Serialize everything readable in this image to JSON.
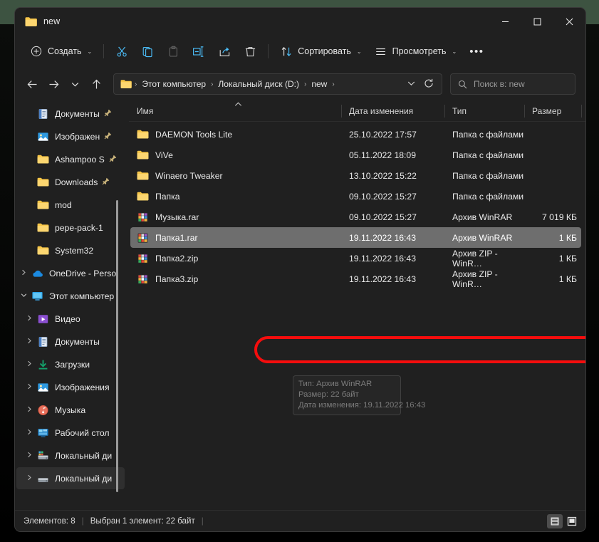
{
  "window": {
    "title": "new",
    "minimize_label": "—",
    "maximize_label": "□",
    "close_label": "✕"
  },
  "toolbar": {
    "new_label": "Создать",
    "cut_label": "Вырезать",
    "copy_label": "Копировать",
    "paste_label": "Вставить",
    "rename_label": "Переименовать",
    "share_label": "Поделиться",
    "delete_label": "Удалить",
    "sort_label": "Сортировать",
    "view_label": "Просмотреть",
    "more_label": "•••"
  },
  "address": {
    "back_label": "←",
    "forward_label": "→",
    "recent_label": "⌄",
    "up_label": "↑",
    "crumbs": [
      "Этот компьютер",
      "Локальный диск (D:)",
      "new"
    ],
    "separator": "›",
    "dropdown_label": "⌄",
    "refresh_label": "↻"
  },
  "search": {
    "placeholder": "Поиск в: new"
  },
  "sidebar": {
    "items": [
      {
        "label": "Документы",
        "icon": "documents-icon",
        "chevron": false,
        "pinned": true,
        "indent": 1,
        "selected": false
      },
      {
        "label": "Изображен",
        "icon": "pictures-icon",
        "chevron": false,
        "pinned": true,
        "indent": 1,
        "selected": false
      },
      {
        "label": "Ashampoo S",
        "icon": "folder-icon",
        "chevron": false,
        "pinned": true,
        "indent": 1,
        "selected": false
      },
      {
        "label": "Downloads",
        "icon": "folder-icon",
        "chevron": false,
        "pinned": true,
        "indent": 1,
        "selected": false
      },
      {
        "label": "mod",
        "icon": "folder-icon",
        "chevron": false,
        "pinned": false,
        "indent": 1,
        "selected": false
      },
      {
        "label": "pepe-pack-1",
        "icon": "folder-icon",
        "chevron": false,
        "pinned": false,
        "indent": 1,
        "selected": false
      },
      {
        "label": "System32",
        "icon": "folder-icon",
        "chevron": false,
        "pinned": false,
        "indent": 1,
        "selected": false
      },
      {
        "label": "OneDrive - Perso",
        "icon": "onedrive-icon",
        "chevron": true,
        "pinned": false,
        "indent": 0,
        "selected": false
      },
      {
        "label": "Этот компьютер",
        "icon": "thispc-icon",
        "chevron": true,
        "expanded": true,
        "pinned": false,
        "indent": 0,
        "selected": false
      },
      {
        "label": "Видео",
        "icon": "video-icon",
        "chevron": true,
        "pinned": false,
        "indent": 1,
        "selected": false
      },
      {
        "label": "Документы",
        "icon": "documents-icon",
        "chevron": true,
        "pinned": false,
        "indent": 1,
        "selected": false
      },
      {
        "label": "Загрузки",
        "icon": "downloads-icon",
        "chevron": true,
        "pinned": false,
        "indent": 1,
        "selected": false
      },
      {
        "label": "Изображения",
        "icon": "pictures-icon",
        "chevron": true,
        "pinned": false,
        "indent": 1,
        "selected": false
      },
      {
        "label": "Музыка",
        "icon": "music-icon",
        "chevron": true,
        "pinned": false,
        "indent": 1,
        "selected": false
      },
      {
        "label": "Рабочий стол",
        "icon": "desktop-icon",
        "chevron": true,
        "pinned": false,
        "indent": 1,
        "selected": false
      },
      {
        "label": "Локальный ди",
        "icon": "sysdrive-icon",
        "chevron": true,
        "pinned": false,
        "indent": 1,
        "selected": false
      },
      {
        "label": "Локальный ди",
        "icon": "drive-icon",
        "chevron": true,
        "pinned": false,
        "indent": 1,
        "selected": true
      }
    ]
  },
  "columns": {
    "name": "Имя",
    "date": "Дата изменения",
    "type": "Тип",
    "size": "Размер",
    "sort_indicator": "⌃"
  },
  "files": [
    {
      "name": "DAEMON Tools Lite",
      "date": "25.10.2022 17:57",
      "type": "Папка с файлами",
      "size": "",
      "icon": "folder-icon",
      "selected": false
    },
    {
      "name": "ViVe",
      "date": "05.11.2022 18:09",
      "type": "Папка с файлами",
      "size": "",
      "icon": "folder-icon",
      "selected": false
    },
    {
      "name": "Winaero Tweaker",
      "date": "13.10.2022 15:22",
      "type": "Папка с файлами",
      "size": "",
      "icon": "folder-icon",
      "selected": false
    },
    {
      "name": "Папка",
      "date": "09.10.2022 15:27",
      "type": "Папка с файлами",
      "size": "",
      "icon": "folder-icon",
      "selected": false
    },
    {
      "name": "Музыка.rar",
      "date": "09.10.2022 15:27",
      "type": "Архив WinRAR",
      "size": "7 019 КБ",
      "icon": "winrar-icon",
      "selected": false
    },
    {
      "name": "Папка1.rar",
      "date": "19.11.2022 16:43",
      "type": "Архив WinRAR",
      "size": "1 КБ",
      "icon": "winrar-icon",
      "selected": true
    },
    {
      "name": "Папка2.zip",
      "date": "19.11.2022 16:43",
      "type": "Архив ZIP - WinR…",
      "size": "1 КБ",
      "icon": "winrar-icon",
      "selected": false
    },
    {
      "name": "Папка3.zip",
      "date": "19.11.2022 16:43",
      "type": "Архив ZIP - WinR…",
      "size": "1 КБ",
      "icon": "winrar-icon",
      "selected": false
    }
  ],
  "tooltip": {
    "line1": "Тип: Архив WinRAR",
    "line2": "Размер: 22 байт",
    "line3": "Дата изменения: 19.11.2022 16:43"
  },
  "statusbar": {
    "count": "Элементов: 8",
    "selection": "Выбран 1 элемент: 22 байт",
    "sep": "|",
    "details_view_label": "Таблица",
    "tiles_view_label": "Крупные значки"
  },
  "colors": {
    "accent": "#4cc2ff",
    "annotation": "#f50d0d",
    "selection": "#6e6e6e",
    "window_bg": "#202020",
    "backdrop_top": "#3d5341"
  }
}
